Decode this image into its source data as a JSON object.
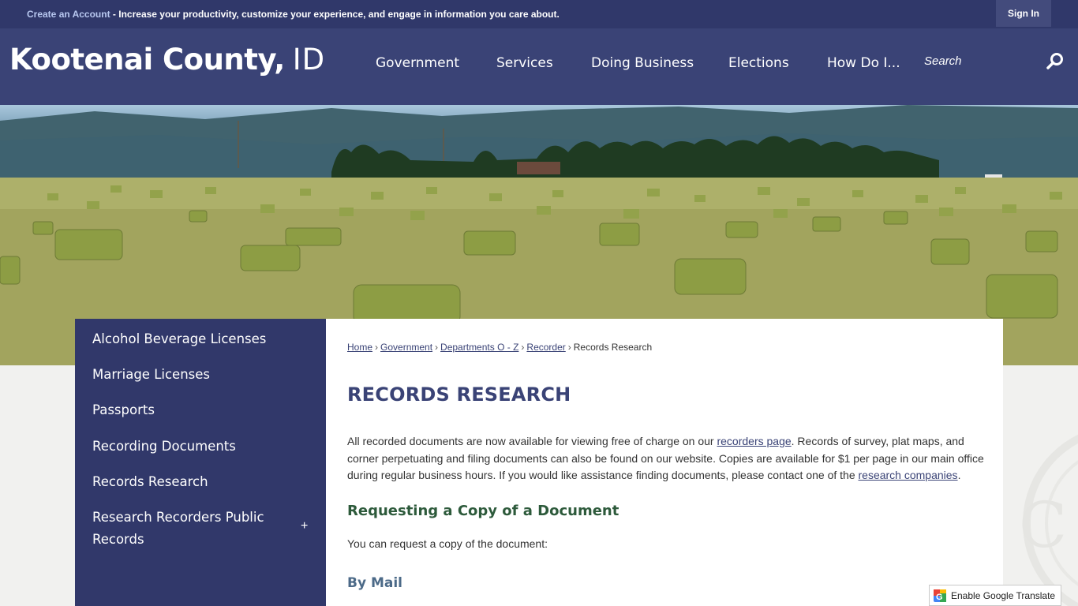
{
  "topbar": {
    "create_account": "Create an Account",
    "message": " - Increase your productivity, customize your experience, and engage in information you care about.",
    "sign_in": "Sign In"
  },
  "header": {
    "logo_name": "Kootenai County,",
    "logo_state": "ID",
    "nav": [
      "Government",
      "Services",
      "Doing Business",
      "Elections",
      "How Do I..."
    ],
    "search_placeholder": "Search"
  },
  "sidebar": {
    "items": [
      "Alcohol Beverage Licenses",
      "Marriage Licenses",
      "Passports",
      "Recording Documents",
      "Records Research",
      "Research Recorders Public",
      "Records"
    ],
    "expand_symbol": "+"
  },
  "breadcrumb": {
    "items": [
      "Home",
      "Government",
      "Departments O - Z",
      "Recorder"
    ],
    "current": "Records Research",
    "separator": "›"
  },
  "content": {
    "title": "RECORDS RESEARCH",
    "para_1": "All recorded documents are now available for viewing free of charge on our ",
    "link_recorders": "recorders page",
    "para_2": ". Records of survey, plat maps, and corner perpetuating and filing documents can also be found on our website. Copies are available for $1 per page in our main office during regular business hours. If you would like assistance finding documents, please contact one of the ",
    "link_research": "research companies",
    "para_3": ".",
    "heading_copy": "Requesting a Copy of a Document",
    "request_text": "You can request a copy of the document:",
    "heading_mail": "By Mail"
  },
  "translate": {
    "label": "Enable Google Translate"
  },
  "colors": {
    "topbar": "#30386a",
    "header": "#3a4376",
    "sidebar": "#31386a",
    "heading_green": "#2d5a3b",
    "title_navy": "#3a4376"
  },
  "icons": [
    "search-icon",
    "google-translate-icon",
    "plus-icon"
  ]
}
